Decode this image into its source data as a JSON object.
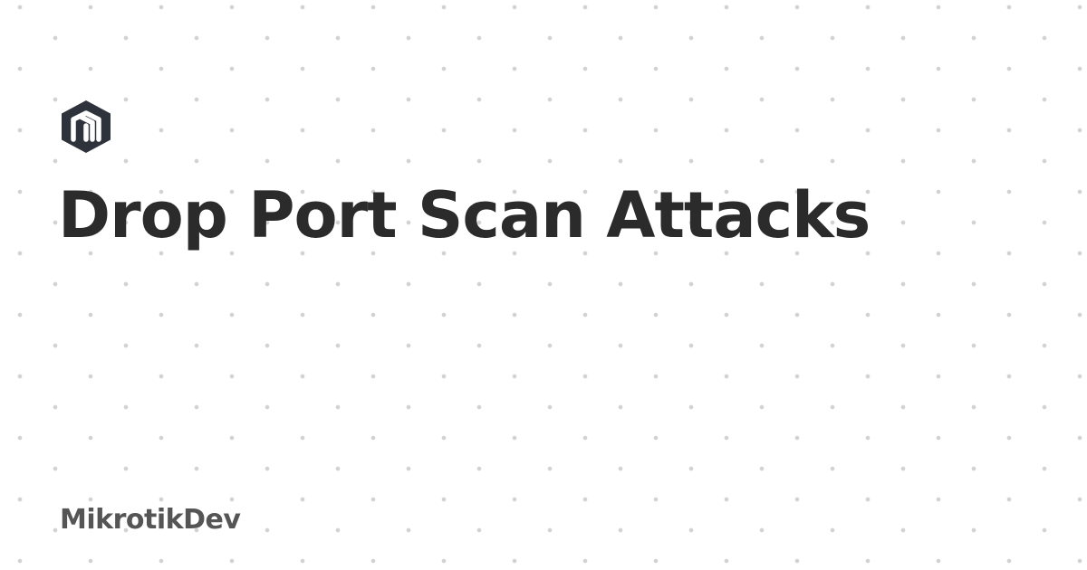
{
  "header": {
    "logo_icon": "mikrotik-logo-icon",
    "title": "Drop Port Scan Attacks"
  },
  "footer": {
    "brand": "MikrotikDev"
  },
  "colors": {
    "background": "#ffffff",
    "dots": "#d2d2d2",
    "title": "#2b2b2b",
    "brand": "#555555",
    "logo": "#2e333b"
  }
}
